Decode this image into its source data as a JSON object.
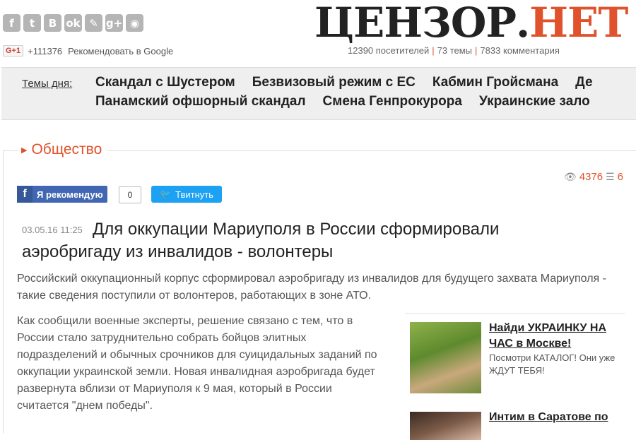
{
  "header": {
    "social_icons": [
      {
        "name": "facebook-icon",
        "glyph": "f"
      },
      {
        "name": "twitter-icon",
        "glyph": "t"
      },
      {
        "name": "vk-icon",
        "glyph": "B"
      },
      {
        "name": "odnoklassniki-icon",
        "glyph": "ok"
      },
      {
        "name": "livejournal-icon",
        "glyph": "✎"
      },
      {
        "name": "googleplus-icon",
        "glyph": "g+"
      },
      {
        "name": "rss-icon",
        "glyph": "◉"
      }
    ],
    "gplus_badge": "G+1",
    "gplus_count": "+111376",
    "gplus_text": "Рекомендовать в Google",
    "logo_part1": "ЦЕНЗОР",
    "logo_dot": ".",
    "logo_part2": "НЕТ",
    "stats": {
      "visitors": "12390 посетителей",
      "topics": "73 темы",
      "comments": "7833 комментария"
    },
    "brand_color": "#e0522b"
  },
  "topics": {
    "label": "Темы дня:",
    "line1": [
      "Скандал с Шустером",
      "Безвизовый режим с ЕС",
      "Кабмин Гройсмана",
      "Де"
    ],
    "line2": [
      "Панамский офшорный скандал",
      "Смена Генпрокурора",
      "Украинские зало"
    ]
  },
  "section": {
    "title": "Общество",
    "views": "4376",
    "comments": "6"
  },
  "share": {
    "fb_label": "Я рекомендую",
    "fb_count": "0",
    "tw_label": "Твитнуть"
  },
  "article": {
    "date": "03.05.16 11:25",
    "title": "Для оккупации Мариуполя в России сформировали аэробригаду из инвалидов - волонтеры",
    "lead": "Российский оккупационный корпус сформировал аэробригаду из инвалидов для будущего захвата Мариуполя - такие сведения поступили от волонтеров, работающих в зоне АТО.",
    "body": "Как сообщили военные эксперты, решение связано с тем, что в России стало затруднительно собрать бойцов элитных подразделений и обычных срочников для суицидальных заданий по оккупации украинской земли. Новая инвалидная аэробригада будет развернута вблизи от Мариуполя к 9 мая, который в России считается \"днем победы\"."
  },
  "ads": [
    {
      "title": "Найди УКРАИНКУ НА ЧАС в Москве!",
      "text": "Посмотри КАТАЛОГ! Они уже ЖДУТ ТЕБЯ!"
    },
    {
      "title": "Интим в Саратове по",
      "text": ""
    }
  ]
}
